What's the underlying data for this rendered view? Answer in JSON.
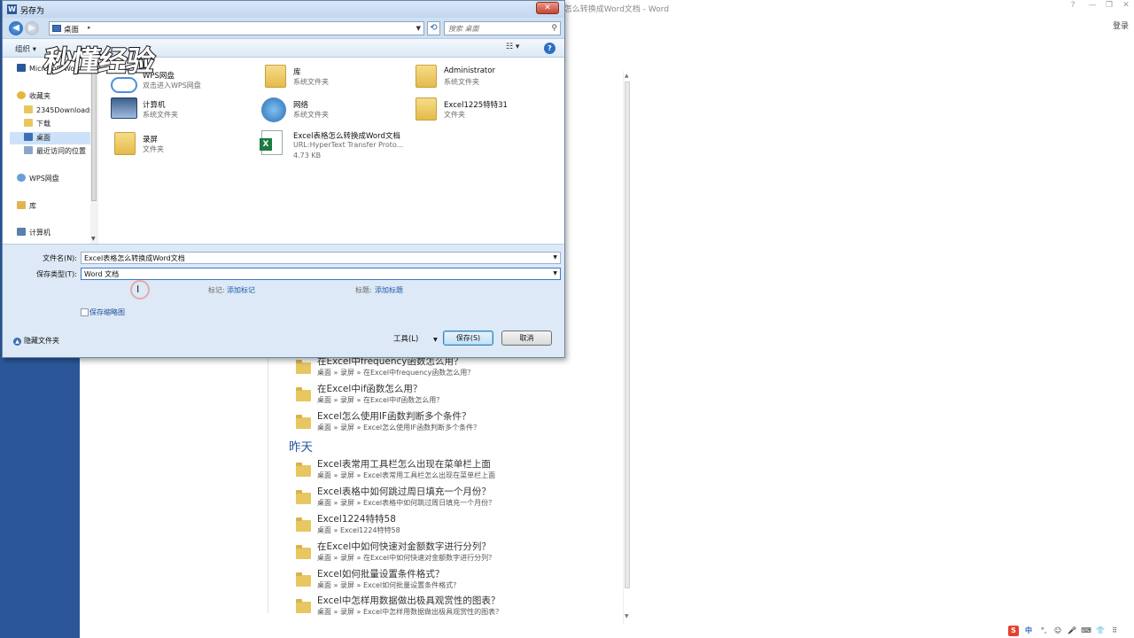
{
  "word": {
    "title": "Excel表格怎么转换成Word文档 - Word",
    "controls": [
      "?",
      "—",
      "❐",
      "✕"
    ],
    "login": "登录",
    "section_yesterday": "昨天",
    "recent_items": [
      {
        "name": "在Excel中frequency函数怎么用？",
        "path": "桌面 » 录屏 » 在Excel中frequency函数怎么用？"
      },
      {
        "name": "在Excel中if函数怎么用？",
        "path": "桌面 » 录屏 » 在Excel中if函数怎么用？"
      },
      {
        "name": "Excel怎么使用IF函数判断多个条件？",
        "path": "桌面 » 录屏 » Excel怎么使用IF函数判断多个条件？"
      },
      {
        "name": "Excel表常用工具栏怎么出现在菜单栏上面",
        "path": "桌面 » 录屏 » Excel表常用工具栏怎么出现在菜单栏上面"
      },
      {
        "name": "Excel表格中如何跳过周日填充一个月份？",
        "path": "桌面 » 录屏 » Excel表格中如何跳过周日填充一个月份？"
      },
      {
        "name": "Excel1224特特58",
        "path": "桌面 » Excel1224特特58"
      },
      {
        "name": "在Excel中如何快速对金额数字进行分列？",
        "path": "桌面 » 录屏 » 在Excel中如何快速对金额数字进行分列？"
      },
      {
        "name": "Excel如何批量设置条件格式？",
        "path": "桌面 » 录屏 » Excel如何批量设置条件格式？"
      },
      {
        "name": "Excel中怎样用数据做出极具观赏性的图表？",
        "path": "桌面 » 录屏 » Excel中怎样用数据做出极具观赏性的图表？"
      }
    ]
  },
  "dialog": {
    "title": "另存为",
    "address": "桌面",
    "search_placeholder": "搜索 桌面",
    "organize": "组织 ▾",
    "nav_items": [
      "Microsoft Word",
      "收藏夹",
      "2345Downloads",
      "下载",
      "桌面",
      "最近访问的位置",
      "WPS网盘",
      "库",
      "计算机"
    ],
    "files": [
      {
        "name": "WPS网盘",
        "type": "双击进入WPS网盘",
        "size": "",
        "icon": "cloud-icon"
      },
      {
        "name": "库",
        "type": "系统文件夹",
        "size": "",
        "icon": "library-icon"
      },
      {
        "name": "Administrator",
        "type": "系统文件夹",
        "size": "",
        "icon": "user-folder-icon"
      },
      {
        "name": "计算机",
        "type": "系统文件夹",
        "size": "",
        "icon": "computer-icon"
      },
      {
        "name": "网络",
        "type": "系统文件夹",
        "size": "",
        "icon": "network-icon"
      },
      {
        "name": "Excel1225特特31",
        "type": "文件夹",
        "size": "",
        "icon": "folder-icon"
      },
      {
        "name": "录屏",
        "type": "文件夹",
        "size": "",
        "icon": "folder-icon"
      },
      {
        "name": "Excel表格怎么转换成Word文档",
        "type": "URL:HyperText Transfer Proto...",
        "size": "4.73 KB",
        "icon": "excel-file-icon"
      }
    ],
    "filename_label": "文件名(N):",
    "filename_value": "Excel表格怎么转换成Word文档",
    "savetype_label": "保存类型(T):",
    "savetype_value": "Word 文档",
    "tags_label": "标记:",
    "tags_link": "添加标记",
    "title_label": "标题:",
    "title_link": "添加标题",
    "save_thumbnail": "保存缩略图",
    "hide_folders": "隐藏文件夹",
    "tools": "工具(L)",
    "save": "保存(S)",
    "cancel": "取消"
  },
  "watermark": "秒懂经验",
  "tray": [
    "S",
    "中",
    "°,",
    "☺",
    "🎤",
    "⌨",
    "👕",
    "⠿"
  ],
  "colors": {
    "word_blue": "#2b579a",
    "folder_yellow": "#e8c660",
    "link_blue": "#1c5aa8"
  }
}
